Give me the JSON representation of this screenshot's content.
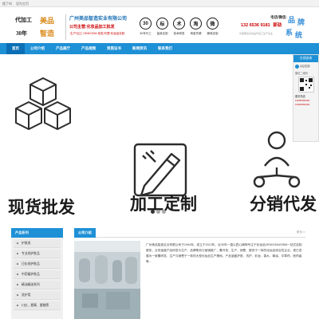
{
  "topbar": {
    "items": [
      "搜了吗",
      "设为主页"
    ]
  },
  "logo": {
    "line1": "代加工",
    "line2": "30年",
    "brand1": "美品",
    "brand2": "智造"
  },
  "company": {
    "name": "广州美品智造实业有限公司",
    "main": "公司主营:化妆品加工批发",
    "sub": "·生产/加工·OEM/ODM·批发/代理·化妆品定制"
  },
  "features": [
    {
      "icon": "30",
      "label": "30年代工"
    },
    {
      "icon": "标",
      "label": "量身定制"
    },
    {
      "icon": "术",
      "label": "技术研发"
    },
    {
      "icon": "淘",
      "label": "淘宝货源"
    },
    {
      "icon": "微",
      "label": "微商定制"
    }
  ],
  "contact": {
    "label": "电话/微信:",
    "phone": "132 6536 9181",
    "name": "郭劲",
    "desc": "中国著名化妆品代加工生产企业"
  },
  "brand_side": {
    "line1": "品",
    "line2": "牌",
    "line3": "系",
    "line4": "统"
  },
  "nav": {
    "items": [
      "首页",
      "公司介绍",
      "产品展厅",
      "产品视频",
      "资质证书",
      "新闻资讯",
      "联系我们"
    ]
  },
  "banner": {
    "captions": [
      "现货批发",
      "加工定制",
      "分销代发"
    ]
  },
  "slider": {
    "count": 3,
    "active": 0
  },
  "side_float": {
    "title": "在线咨询",
    "qq_label": "QQ交谈",
    "scan_label": "微信二维码",
    "tel_label": "服务热线",
    "tel1": "13265369181",
    "tel2": "13265369181"
  },
  "products": {
    "title": "产品系列",
    "items": [
      "护肤类",
      "专业线护肤品",
      "日化线护肤品",
      "中药精护肤品",
      "精油精油系列",
      "洗护类",
      "口红、唇膏、唇釉等"
    ]
  },
  "about": {
    "tab": "公司介绍",
    "more": "更多>>",
    "text": "广州美品智造实业有限公司于1994年，成立于2012年，近30年一直以匠心精神专注于化妆品OEM/ODM/OBM一站式定制服务，业务涵盖产品研发与生产、品牌策划与营销推广，集开发、生产、销售、服务于一体的化妆品综合性企业，现已发展为一家集研发、生产与销售于一体的大型化妆品生产基地，产品涵盖护肤、洗护、彩妆、香水、精油、中草药、医药级等..."
  }
}
